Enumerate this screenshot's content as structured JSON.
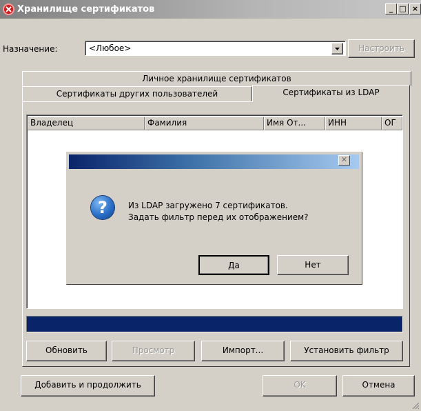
{
  "window": {
    "title": "Хранилище сертификатов",
    "controls": {
      "minimize": "_",
      "maximize": "□",
      "close": "×"
    }
  },
  "purpose": {
    "label": "Назначение:",
    "selected": "<Любое>",
    "configure_button": "Настроить"
  },
  "tabs": {
    "row_back": [
      "Личное хранилище сертификатов"
    ],
    "row_front": [
      "Сертификаты других пользователей",
      "Сертификаты из LDAP"
    ],
    "active": "Сертификаты из LDAP"
  },
  "table": {
    "columns": [
      "Владелец",
      "Фамилия",
      "Имя От...",
      "ИНН",
      "ОГ"
    ]
  },
  "dialog": {
    "message_line1": "Из LDAP загружено 7 сертификатов.",
    "message_line2": "Задать фильтр перед их отображением?",
    "yes_button": "Да",
    "no_button": "Нет",
    "icon": "question-icon"
  },
  "progress": {
    "value": 1.0
  },
  "panel_buttons": {
    "refresh": "Обновить",
    "view": "Просмотр",
    "import": "Импорт...",
    "set_filter": "Установить фильтр"
  },
  "bottom_buttons": {
    "add_continue": "Добавить и продолжить",
    "ok": "OK",
    "cancel": "Отмена"
  },
  "colors": {
    "face": "#d4d0c8",
    "progress_fill": "#0a246a",
    "dialog_title_start": "#0a246a",
    "title_icon": "#c81e1e"
  }
}
